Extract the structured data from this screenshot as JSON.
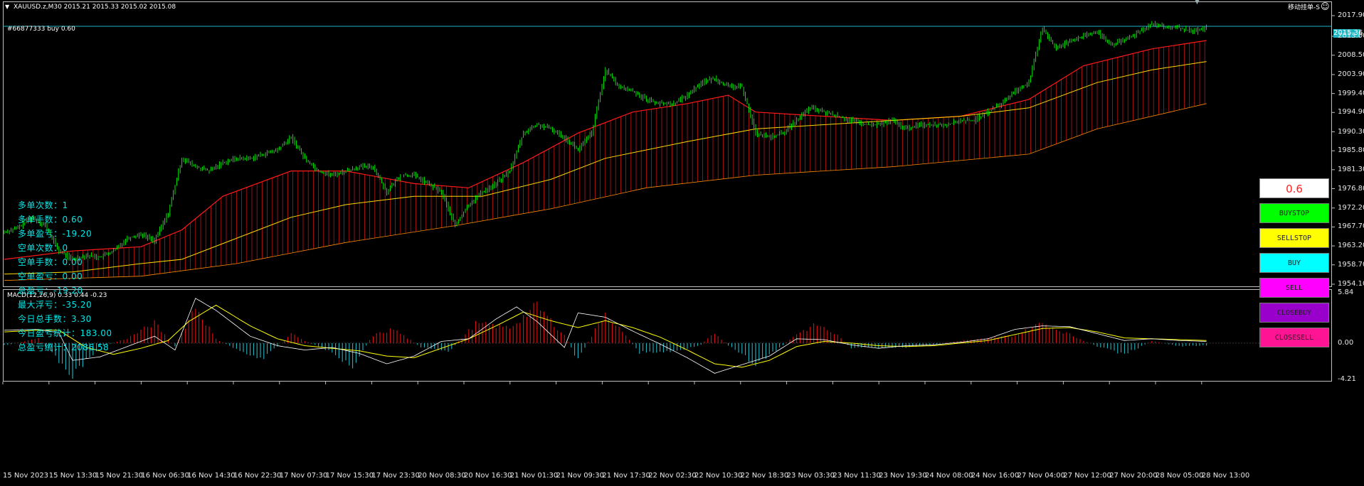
{
  "header": {
    "symbol_line": "XAUUSD.z,M30  2015.21 2015.33 2015.02 2015.08",
    "order_label": "#66877333 buy 0.60",
    "ea_label": "移动挂单-S"
  },
  "price_axis": {
    "ticks": [
      "2017.90",
      "2013.00",
      "2008.50",
      "2003.90",
      "1999.40",
      "1994.90",
      "1990.30",
      "1985.80",
      "1981.30",
      "1976.80",
      "1972.20",
      "1967.70",
      "1963.20",
      "1958.70",
      "1954.10"
    ],
    "current_price": "2015.36"
  },
  "macd": {
    "label": "MACD(12,26,9) 0.33 0.44 -0.23",
    "ticks": [
      "5.84",
      "0.00",
      "-4.21"
    ]
  },
  "time_axis": [
    "15 Nov 2023",
    "15 Nov 13:30",
    "15 Nov 21:30",
    "16 Nov 06:30",
    "16 Nov 14:30",
    "16 Nov 22:30",
    "17 Nov 07:30",
    "17 Nov 15:30",
    "17 Nov 23:30",
    "20 Nov 08:30",
    "20 Nov 16:30",
    "21 Nov 01:30",
    "21 Nov 09:30",
    "21 Nov 17:30",
    "22 Nov 02:30",
    "22 Nov 10:30",
    "22 Nov 18:30",
    "23 Nov 03:30",
    "23 Nov 11:30",
    "23 Nov 19:30",
    "24 Nov 08:00",
    "24 Nov 16:00",
    "27 Nov 04:00",
    "27 Nov 12:00",
    "27 Nov 20:00",
    "28 Nov 05:00",
    "28 Nov 13:00"
  ],
  "stats": [
    "多单次数：1",
    "多单手数：0.60",
    "多单盈亏：-19.20",
    "空单次数：0",
    "空单手数：0.00",
    "空单盈亏：0.00",
    "总盈亏：-19.20",
    "最大浮亏：-35.20",
    "今日总手数：3.30",
    "今日盈亏统计：183.00",
    "总盈亏统计：2086.58"
  ],
  "panel": {
    "lot": "0.6",
    "buttons": [
      {
        "label": "BUYSTOP",
        "color": "#00ff00"
      },
      {
        "label": "SELLSTOP",
        "color": "#ffff00"
      },
      {
        "label": "BUY",
        "color": "#00ffff"
      },
      {
        "label": "SELL",
        "color": "#ff00ff"
      },
      {
        "label": "CLOSEBUY",
        "color": "#9900cc"
      },
      {
        "label": "CLOSESELL",
        "color": "#ff1493"
      }
    ]
  },
  "chart_data": {
    "type": "line",
    "symbol": "XAUUSD.z",
    "timeframe": "M30",
    "ylim": [
      1954.1,
      2017.9
    ],
    "price": [
      [
        0,
        1966.5
      ],
      [
        8,
        1967.5
      ],
      [
        16,
        1970
      ],
      [
        24,
        1968
      ],
      [
        32,
        1962
      ],
      [
        40,
        1960
      ],
      [
        48,
        1961
      ],
      [
        56,
        1960.5
      ],
      [
        64,
        1962
      ],
      [
        72,
        1965
      ],
      [
        80,
        1966
      ],
      [
        88,
        1964.5
      ],
      [
        96,
        1971
      ],
      [
        104,
        1984
      ],
      [
        112,
        1982
      ],
      [
        120,
        1981
      ],
      [
        128,
        1983
      ],
      [
        136,
        1984
      ],
      [
        144,
        1984
      ],
      [
        152,
        1985
      ],
      [
        160,
        1986
      ],
      [
        168,
        1989
      ],
      [
        176,
        1984
      ],
      [
        184,
        1981
      ],
      [
        192,
        1980
      ],
      [
        200,
        1981
      ],
      [
        208,
        1982
      ],
      [
        216,
        1982
      ],
      [
        224,
        1976
      ],
      [
        232,
        1980
      ],
      [
        240,
        1980
      ],
      [
        248,
        1978
      ],
      [
        256,
        1976
      ],
      [
        264,
        1968
      ],
      [
        272,
        1973
      ],
      [
        280,
        1976
      ],
      [
        288,
        1978
      ],
      [
        296,
        1981
      ],
      [
        304,
        1990
      ],
      [
        312,
        1992
      ],
      [
        320,
        1991
      ],
      [
        328,
        1989
      ],
      [
        336,
        1986
      ],
      [
        344,
        1990
      ],
      [
        352,
        2005
      ],
      [
        360,
        2001
      ],
      [
        368,
        2000
      ],
      [
        376,
        1998
      ],
      [
        384,
        1997
      ],
      [
        392,
        1997
      ],
      [
        400,
        1999
      ],
      [
        408,
        2002
      ],
      [
        416,
        2003
      ],
      [
        424,
        2001
      ],
      [
        432,
        2001
      ],
      [
        440,
        1990
      ],
      [
        448,
        1989
      ],
      [
        456,
        1990
      ],
      [
        464,
        1993
      ],
      [
        472,
        1996
      ],
      [
        480,
        1995
      ],
      [
        488,
        1994
      ],
      [
        496,
        1993
      ],
      [
        504,
        1992
      ],
      [
        512,
        1992
      ],
      [
        520,
        1993
      ],
      [
        528,
        1991
      ],
      [
        536,
        1992
      ],
      [
        544,
        1992
      ],
      [
        552,
        1992
      ],
      [
        560,
        1993
      ],
      [
        568,
        1993
      ],
      [
        576,
        1995
      ],
      [
        584,
        1997
      ],
      [
        592,
        2000
      ],
      [
        600,
        2002
      ],
      [
        608,
        2015
      ],
      [
        616,
        2010
      ],
      [
        624,
        2012
      ],
      [
        632,
        2013
      ],
      [
        640,
        2014
      ],
      [
        648,
        2011
      ],
      [
        656,
        2012
      ],
      [
        664,
        2014
      ],
      [
        672,
        2016
      ],
      [
        680,
        2015
      ],
      [
        688,
        2015
      ],
      [
        696,
        2014
      ],
      [
        704,
        2015
      ]
    ],
    "ma_slow": [
      [
        0,
        1956.5
      ],
      [
        40,
        1957
      ],
      [
        80,
        1959
      ],
      [
        104,
        1960
      ],
      [
        136,
        1965
      ],
      [
        168,
        1970
      ],
      [
        200,
        1973
      ],
      [
        240,
        1975
      ],
      [
        280,
        1975
      ],
      [
        320,
        1979
      ],
      [
        352,
        1984
      ],
      [
        400,
        1988
      ],
      [
        440,
        1991
      ],
      [
        480,
        1992
      ],
      [
        520,
        1993
      ],
      [
        560,
        1994
      ],
      [
        600,
        1996
      ],
      [
        640,
        2002
      ],
      [
        672,
        2005
      ],
      [
        704,
        2007
      ]
    ],
    "band_upper": [
      [
        0,
        1960
      ],
      [
        40,
        1962
      ],
      [
        80,
        1963
      ],
      [
        104,
        1967
      ],
      [
        128,
        1975
      ],
      [
        168,
        1981
      ],
      [
        200,
        1981
      ],
      [
        240,
        1978
      ],
      [
        272,
        1977
      ],
      [
        304,
        1983
      ],
      [
        336,
        1990
      ],
      [
        368,
        1995
      ],
      [
        400,
        1997
      ],
      [
        424,
        1999
      ],
      [
        440,
        1995
      ],
      [
        480,
        1994
      ],
      [
        520,
        1993
      ],
      [
        560,
        1994
      ],
      [
        600,
        1998
      ],
      [
        632,
        2006
      ],
      [
        672,
        2010
      ],
      [
        704,
        2012
      ]
    ],
    "band_lower": [
      [
        0,
        1955
      ],
      [
        80,
        1956
      ],
      [
        136,
        1959
      ],
      [
        200,
        1964
      ],
      [
        264,
        1968
      ],
      [
        320,
        1972
      ],
      [
        376,
        1977
      ],
      [
        440,
        1980
      ],
      [
        520,
        1982
      ],
      [
        600,
        1985
      ],
      [
        640,
        1991
      ],
      [
        704,
        1997
      ]
    ],
    "macd_hist": [
      [
        0,
        -0.3
      ],
      [
        20,
        0.6
      ],
      [
        40,
        -4.2
      ],
      [
        56,
        -0.5
      ],
      [
        72,
        0.6
      ],
      [
        88,
        2.6
      ],
      [
        100,
        -0.5
      ],
      [
        112,
        4.8
      ],
      [
        124,
        0.5
      ],
      [
        140,
        -1.2
      ],
      [
        152,
        -2.0
      ],
      [
        168,
        1.2
      ],
      [
        176,
        0.3
      ],
      [
        188,
        -0.8
      ],
      [
        204,
        -2.9
      ],
      [
        216,
        1.0
      ],
      [
        228,
        1.8
      ],
      [
        244,
        -0.5
      ],
      [
        260,
        -1.2
      ],
      [
        276,
        2.5
      ],
      [
        296,
        2.0
      ],
      [
        312,
        4.8
      ],
      [
        328,
        1.0
      ],
      [
        336,
        -2.2
      ],
      [
        352,
        4.0
      ],
      [
        372,
        -1.2
      ],
      [
        392,
        -1.1
      ],
      [
        408,
        -0.2
      ],
      [
        416,
        1.3
      ],
      [
        424,
        -0.3
      ],
      [
        440,
        -2.8
      ],
      [
        452,
        -1.0
      ],
      [
        464,
        1.2
      ],
      [
        476,
        2.4
      ],
      [
        488,
        1.0
      ],
      [
        496,
        -0.6
      ],
      [
        512,
        -0.6
      ],
      [
        528,
        -0.6
      ],
      [
        544,
        -0.2
      ],
      [
        560,
        0.3
      ],
      [
        576,
        0.6
      ],
      [
        592,
        1.0
      ],
      [
        608,
        2.6
      ],
      [
        624,
        1.1
      ],
      [
        640,
        -0.4
      ],
      [
        656,
        -1.5
      ],
      [
        672,
        0.3
      ],
      [
        688,
        -0.4
      ],
      [
        704,
        -0.3
      ]
    ],
    "macd_line": [
      [
        0,
        1.5
      ],
      [
        20,
        1.6
      ],
      [
        32,
        1.2
      ],
      [
        40,
        -2.0
      ],
      [
        56,
        -1.6
      ],
      [
        72,
        -0.4
      ],
      [
        88,
        0.8
      ],
      [
        100,
        -0.8
      ],
      [
        112,
        5.2
      ],
      [
        124,
        3.8
      ],
      [
        144,
        0.8
      ],
      [
        160,
        -0.3
      ],
      [
        176,
        -0.8
      ],
      [
        192,
        -0.5
      ],
      [
        208,
        -1.2
      ],
      [
        224,
        -2.4
      ],
      [
        240,
        -1.5
      ],
      [
        256,
        0.2
      ],
      [
        272,
        0.5
      ],
      [
        288,
        2.8
      ],
      [
        300,
        4.2
      ],
      [
        312,
        2.5
      ],
      [
        328,
        -0.5
      ],
      [
        336,
        3.5
      ],
      [
        352,
        3.0
      ],
      [
        368,
        1.4
      ],
      [
        384,
        -0.1
      ],
      [
        400,
        -1.7
      ],
      [
        416,
        -3.5
      ],
      [
        432,
        -2.5
      ],
      [
        448,
        -1.5
      ],
      [
        464,
        0.5
      ],
      [
        480,
        0.4
      ],
      [
        496,
        -0.2
      ],
      [
        512,
        -0.6
      ],
      [
        528,
        -0.3
      ],
      [
        544,
        -0.2
      ],
      [
        560,
        0.1
      ],
      [
        576,
        0.5
      ],
      [
        592,
        1.6
      ],
      [
        608,
        2.0
      ],
      [
        624,
        1.9
      ],
      [
        640,
        1.1
      ],
      [
        656,
        0.3
      ],
      [
        672,
        0.5
      ],
      [
        688,
        0.3
      ],
      [
        704,
        0.2
      ]
    ],
    "signal_line": [
      [
        0,
        1.3
      ],
      [
        20,
        1.5
      ],
      [
        32,
        1.5
      ],
      [
        48,
        -0.5
      ],
      [
        64,
        -1.3
      ],
      [
        80,
        -0.6
      ],
      [
        96,
        0.3
      ],
      [
        108,
        2.5
      ],
      [
        124,
        4.4
      ],
      [
        144,
        2.0
      ],
      [
        160,
        0.5
      ],
      [
        176,
        -0.3
      ],
      [
        192,
        -0.6
      ],
      [
        208,
        -0.9
      ],
      [
        224,
        -1.5
      ],
      [
        240,
        -1.7
      ],
      [
        256,
        -0.6
      ],
      [
        272,
        0.5
      ],
      [
        288,
        2.0
      ],
      [
        304,
        3.6
      ],
      [
        320,
        2.6
      ],
      [
        336,
        1.8
      ],
      [
        352,
        2.6
      ],
      [
        368,
        1.8
      ],
      [
        384,
        0.7
      ],
      [
        400,
        -0.8
      ],
      [
        416,
        -2.4
      ],
      [
        432,
        -2.8
      ],
      [
        448,
        -2.0
      ],
      [
        464,
        -0.4
      ],
      [
        480,
        0.2
      ],
      [
        496,
        0.0
      ],
      [
        512,
        -0.3
      ],
      [
        528,
        -0.4
      ],
      [
        544,
        -0.3
      ],
      [
        560,
        0.0
      ],
      [
        576,
        0.3
      ],
      [
        592,
        1.0
      ],
      [
        608,
        1.7
      ],
      [
        624,
        1.8
      ],
      [
        640,
        1.3
      ],
      [
        656,
        0.6
      ],
      [
        672,
        0.5
      ],
      [
        688,
        0.4
      ],
      [
        704,
        0.3
      ]
    ],
    "macd_ylim": [
      -4.21,
      5.84
    ],
    "colors": {
      "up": "#00ff00",
      "band": "#ff1a1a",
      "ma": "#ffd700",
      "hist_pos": "#dd1111",
      "hist_neg": "#1fb5c3",
      "macd": "#ffffff",
      "signal": "#ffff00",
      "order": "#1fb5c3"
    }
  }
}
